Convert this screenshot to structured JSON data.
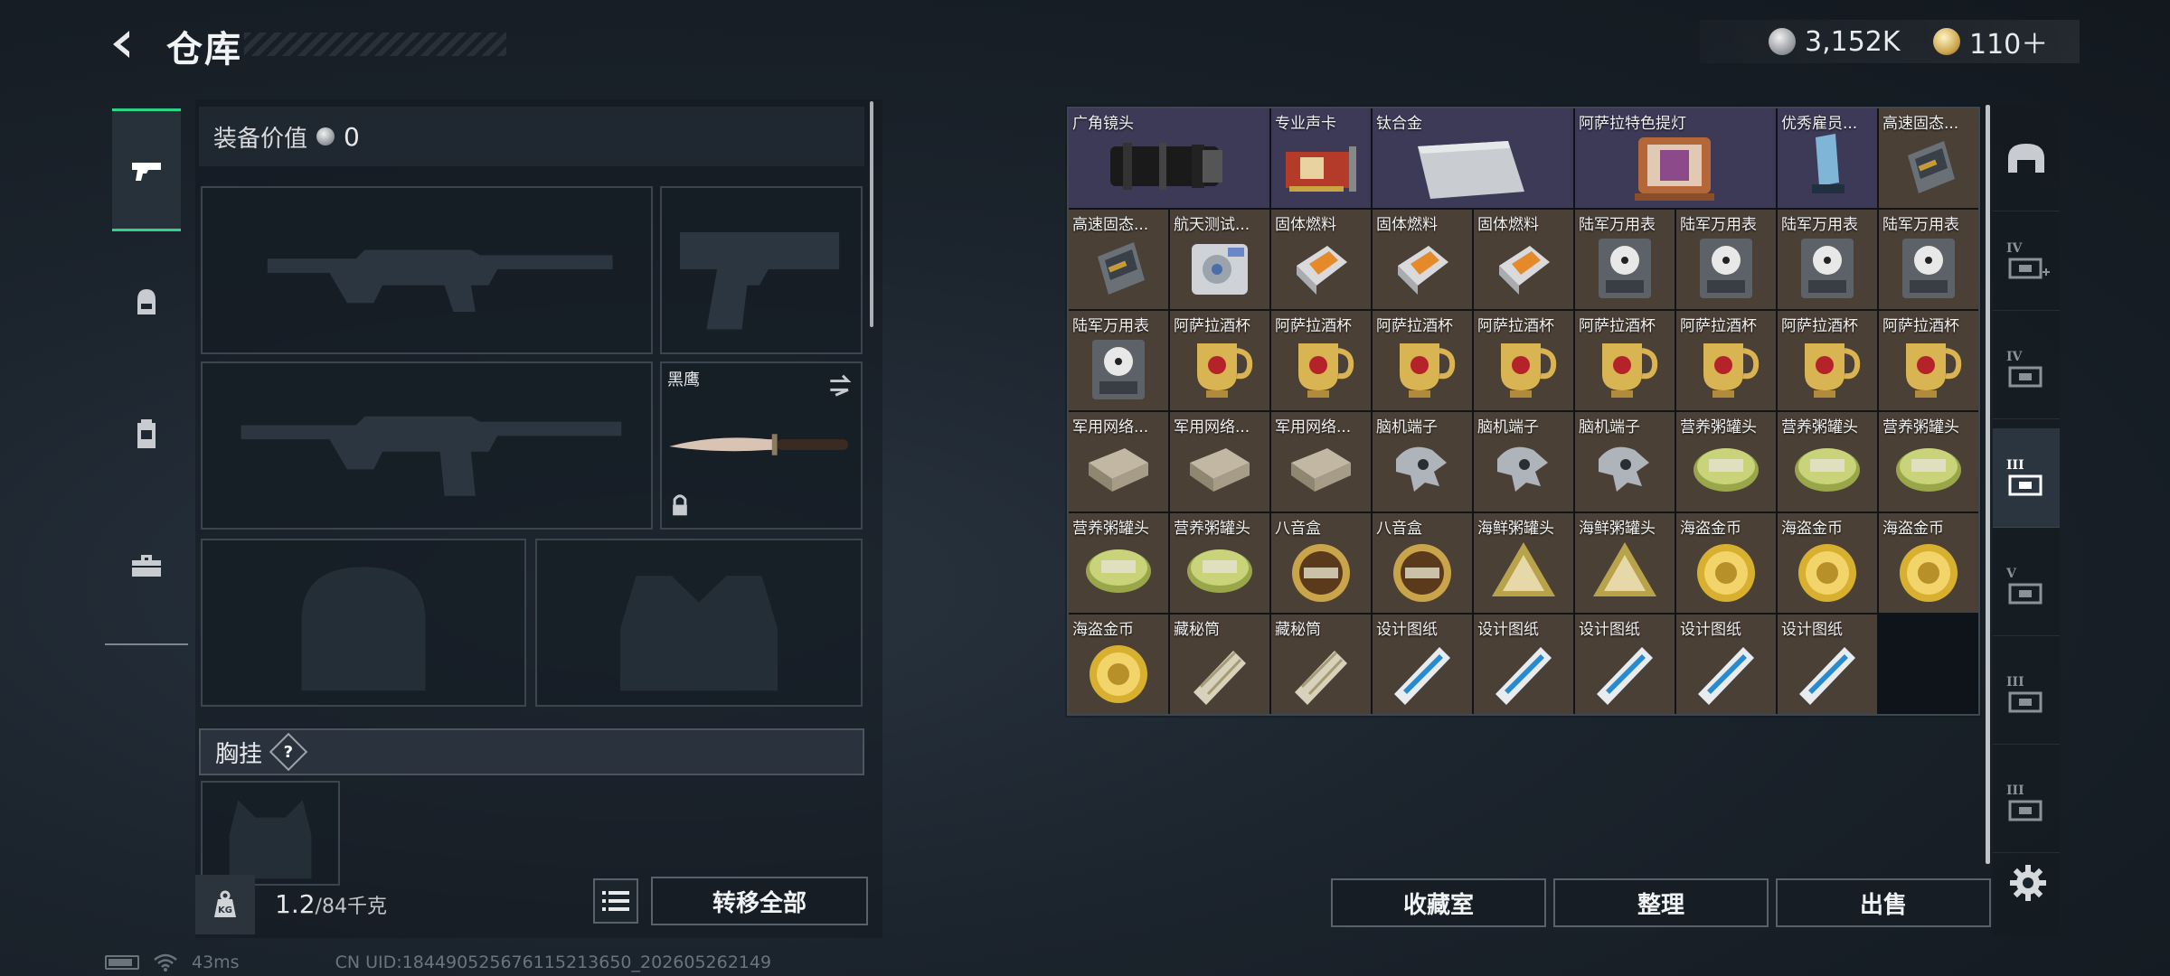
{
  "header": {
    "title": "仓库",
    "currency_silver": "3,152K",
    "currency_gold": "110＋"
  },
  "left_tabs": [
    {
      "name": "weapons",
      "icon": "pistol-icon",
      "active": true
    },
    {
      "name": "armor",
      "icon": "helmet-icon",
      "active": false
    },
    {
      "name": "backpack",
      "icon": "backpack-icon",
      "active": false
    },
    {
      "name": "toolbox",
      "icon": "toolbox-icon",
      "active": false
    }
  ],
  "equipment": {
    "value_label": "装备价值",
    "value": "0",
    "melee_name": "黑鹰",
    "chest_label": "胸挂",
    "chest_help": "?"
  },
  "footer": {
    "weight": "1.2",
    "weight_max": "/84千克",
    "transfer_all": "转移全部",
    "collection_room": "收藏室",
    "organize": "整理",
    "sell": "出售"
  },
  "status": {
    "ping": "43ms",
    "uid": "CN UID:1844905256761152136​50_202605262149"
  },
  "grid_items": [
    {
      "label": "广角镜头",
      "icon": "camera-lens-icon",
      "rarity": "purple",
      "wide": true
    },
    {
      "label": "专业声卡",
      "icon": "sound-card-icon",
      "rarity": "purple",
      "wide": false
    },
    {
      "label": "钛合金",
      "icon": "titanium-plate-icon",
      "rarity": "purple",
      "wide": true
    },
    {
      "label": "阿萨拉特色提灯",
      "icon": "lantern-icon",
      "rarity": "purple",
      "wide": true
    },
    {
      "label": "优秀雇员...",
      "icon": "trophy-icon",
      "rarity": "purple",
      "wide": false
    },
    {
      "label": "高速固态...",
      "icon": "ssd-icon",
      "rarity": "gold",
      "wide": false
    },
    {
      "label": "高速固态...",
      "icon": "ssd-icon",
      "rarity": "gold",
      "wide": false
    },
    {
      "label": "航天测试...",
      "icon": "test-device-icon",
      "rarity": "gold",
      "wide": false
    },
    {
      "label": "固体燃料",
      "icon": "solid-fuel-icon",
      "rarity": "gold",
      "wide": false
    },
    {
      "label": "固体燃料",
      "icon": "solid-fuel-icon",
      "rarity": "gold",
      "wide": false
    },
    {
      "label": "固体燃料",
      "icon": "solid-fuel-icon",
      "rarity": "gold",
      "wide": false
    },
    {
      "label": "陆军万用表",
      "icon": "multimeter-icon",
      "rarity": "gold",
      "wide": false
    },
    {
      "label": "陆军万用表",
      "icon": "multimeter-icon",
      "rarity": "gold",
      "wide": false
    },
    {
      "label": "陆军万用表",
      "icon": "multimeter-icon",
      "rarity": "gold",
      "wide": false
    },
    {
      "label": "陆军万用表",
      "icon": "multimeter-icon",
      "rarity": "gold",
      "wide": false
    },
    {
      "label": "陆军万用表",
      "icon": "multimeter-icon",
      "rarity": "gold",
      "wide": false
    },
    {
      "label": "阿萨拉酒杯",
      "icon": "goblet-icon",
      "rarity": "gold",
      "wide": false
    },
    {
      "label": "阿萨拉酒杯",
      "icon": "goblet-icon",
      "rarity": "gold",
      "wide": false
    },
    {
      "label": "阿萨拉酒杯",
      "icon": "goblet-icon",
      "rarity": "gold",
      "wide": false
    },
    {
      "label": "阿萨拉酒杯",
      "icon": "goblet-icon",
      "rarity": "gold",
      "wide": false
    },
    {
      "label": "阿萨拉酒杯",
      "icon": "goblet-icon",
      "rarity": "gold",
      "wide": false
    },
    {
      "label": "阿萨拉酒杯",
      "icon": "goblet-icon",
      "rarity": "gold",
      "wide": false
    },
    {
      "label": "阿萨拉酒杯",
      "icon": "goblet-icon",
      "rarity": "gold",
      "wide": false
    },
    {
      "label": "阿萨拉酒杯",
      "icon": "goblet-icon",
      "rarity": "gold",
      "wide": false
    },
    {
      "label": "军用网络...",
      "icon": "network-module-icon",
      "rarity": "gold",
      "wide": false
    },
    {
      "label": "军用网络...",
      "icon": "network-module-icon",
      "rarity": "gold",
      "wide": false
    },
    {
      "label": "军用网络...",
      "icon": "network-module-icon",
      "rarity": "gold",
      "wide": false
    },
    {
      "label": "脑机端子",
      "icon": "brain-terminal-icon",
      "rarity": "gold",
      "wide": false
    },
    {
      "label": "脑机端子",
      "icon": "brain-terminal-icon",
      "rarity": "gold",
      "wide": false
    },
    {
      "label": "脑机端子",
      "icon": "brain-terminal-icon",
      "rarity": "gold",
      "wide": false
    },
    {
      "label": "营养粥罐头",
      "icon": "canned-food-icon",
      "rarity": "gold",
      "wide": false
    },
    {
      "label": "营养粥罐头",
      "icon": "canned-food-icon",
      "rarity": "gold",
      "wide": false
    },
    {
      "label": "营养粥罐头",
      "icon": "canned-food-icon",
      "rarity": "gold",
      "wide": false
    },
    {
      "label": "营养粥罐头",
      "icon": "canned-food-icon",
      "rarity": "gold",
      "wide": false
    },
    {
      "label": "营养粥罐头",
      "icon": "canned-food-icon",
      "rarity": "gold",
      "wide": false
    },
    {
      "label": "八音盒",
      "icon": "music-box-icon",
      "rarity": "gold",
      "wide": false
    },
    {
      "label": "八音盒",
      "icon": "music-box-icon",
      "rarity": "gold",
      "wide": false
    },
    {
      "label": "海鲜粥罐头",
      "icon": "seafood-can-icon",
      "rarity": "gold",
      "wide": false
    },
    {
      "label": "海鲜粥罐头",
      "icon": "seafood-can-icon",
      "rarity": "gold",
      "wide": false
    },
    {
      "label": "海盗金币",
      "icon": "gold-coin-icon",
      "rarity": "gold",
      "wide": false
    },
    {
      "label": "海盗金币",
      "icon": "gold-coin-icon",
      "rarity": "gold",
      "wide": false
    },
    {
      "label": "海盗金币",
      "icon": "gold-coin-icon",
      "rarity": "gold",
      "wide": false
    },
    {
      "label": "海盗金币",
      "icon": "gold-coin-icon",
      "rarity": "gold",
      "wide": false
    },
    {
      "label": "藏秘筒",
      "icon": "cryptex-icon",
      "rarity": "gold",
      "wide": false
    },
    {
      "label": "藏秘筒",
      "icon": "cryptex-icon",
      "rarity": "gold",
      "wide": false
    },
    {
      "label": "设计图纸",
      "icon": "blueprint-icon",
      "rarity": "gold",
      "wide": false
    },
    {
      "label": "设计图纸",
      "icon": "blueprint-icon",
      "rarity": "gold",
      "wide": false
    },
    {
      "label": "设计图纸",
      "icon": "blueprint-icon",
      "rarity": "gold",
      "wide": false
    },
    {
      "label": "设计图纸",
      "icon": "blueprint-icon",
      "rarity": "gold",
      "wide": false
    },
    {
      "label": "设计图纸",
      "icon": "blueprint-icon",
      "rarity": "gold",
      "wide": false
    }
  ],
  "right_tabs": [
    {
      "name": "home",
      "icon": "home-icon",
      "level": ""
    },
    {
      "name": "storage-iv-plus",
      "icon": "storage-add-icon",
      "level": "IV"
    },
    {
      "name": "storage-iv",
      "icon": "storage-iv-icon",
      "level": "IV"
    },
    {
      "name": "storage-iii-active",
      "icon": "storage-iii-icon",
      "level": "III"
    },
    {
      "name": "storage-v",
      "icon": "storage-v-icon",
      "level": "V"
    },
    {
      "name": "storage-iii-b",
      "icon": "storage-iii-icon",
      "level": "III"
    },
    {
      "name": "storage-iii-c",
      "icon": "storage-iii-icon",
      "level": "III"
    }
  ],
  "colors": {
    "accent_green": "#2fd48b",
    "rarity_gold": "#4b4036",
    "rarity_purple": "#3d3a57"
  }
}
